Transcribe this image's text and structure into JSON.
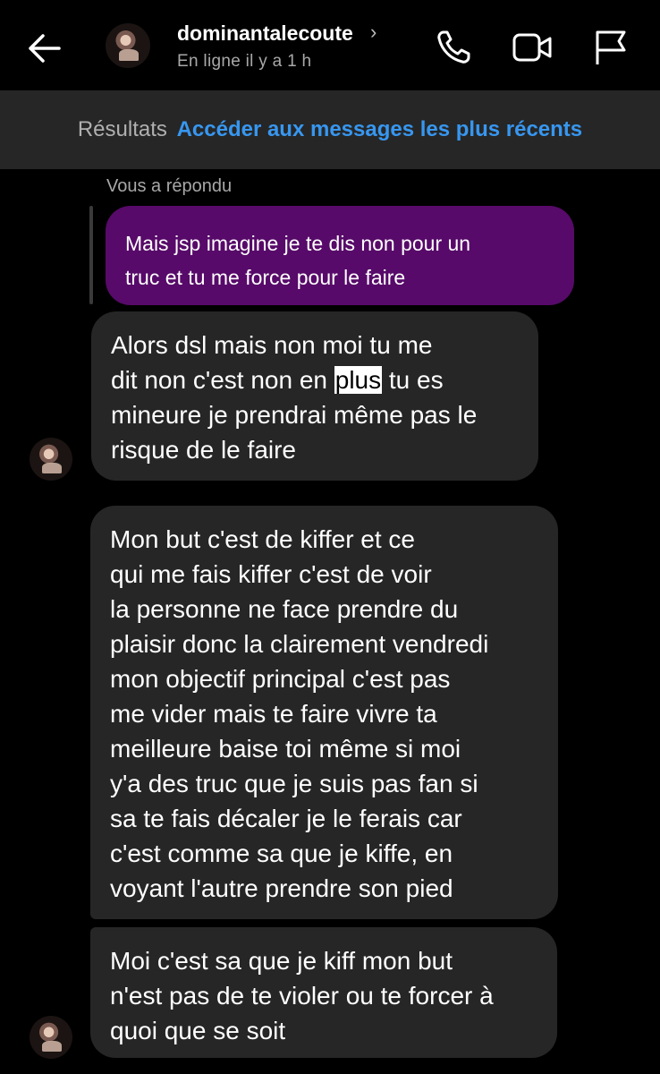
{
  "header": {
    "back_icon": "arrow-left-icon",
    "username": "dominantalecoute",
    "chevron": "›",
    "status": "En ligne il y a 1 h",
    "actions": [
      "phone-icon",
      "video-camera-icon",
      "flag-icon"
    ]
  },
  "banner": {
    "prefix": "Résultats",
    "link": "Accéder aux messages les plus récents",
    "link_color": "#3797f0"
  },
  "thread": {
    "replied_label": "Vous a répondu",
    "quoted_message": {
      "lines": [
        "Mais jsp imagine je te dis non pour un",
        "truc et tu me force pour le faire"
      ],
      "color": "#570a69"
    },
    "messages": [
      {
        "line1": "Alors dsl mais non moi tu me",
        "line2_before": "dit non c'est non en ",
        "line2_highlight": "plus",
        "line2_after": " tu es",
        "line3": "mineure je prendrai même pas le",
        "line4": "risque de le faire"
      },
      {
        "lines": [
          "Mon but c'est de kiffer et ce",
          "qui me fais kiffer c'est de voir",
          "la personne ne face prendre du",
          "plaisir donc la clairement vendredi",
          "mon objectif principal c'est pas",
          "me vider mais te faire vivre ta",
          "meilleure baise toi même si moi",
          "y'a des truc que je suis pas fan si",
          "sa te fais décaler je le ferais car",
          "c'est comme sa que je kiffe, en",
          "voyant l'autre prendre son pied"
        ]
      },
      {
        "lines": [
          "Moi c'est sa que je kiff mon but",
          "n'est pas de te violer ou te forcer à",
          "quoi que se soit"
        ]
      }
    ],
    "bubble_color": "#262626"
  }
}
